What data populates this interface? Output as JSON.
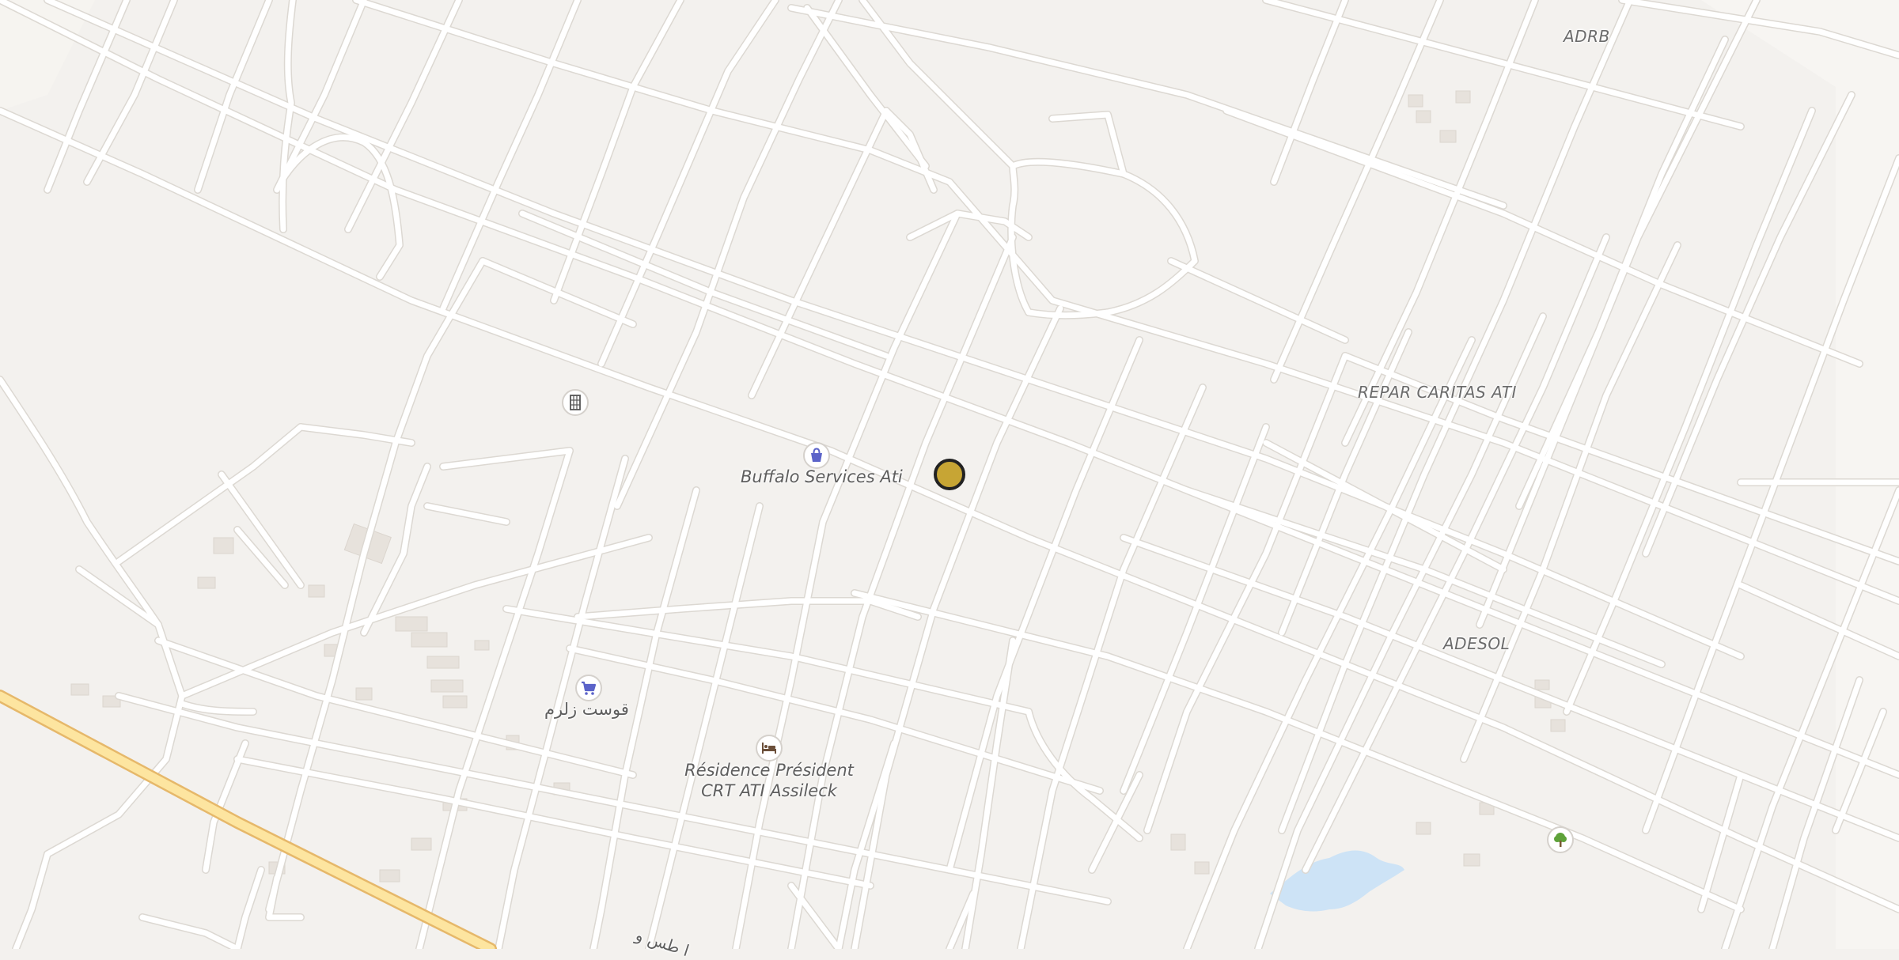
{
  "map": {
    "places": {
      "adrb": "ADRB",
      "repar_caritas": "REPAR CARITAS ATI",
      "adesol": "ADESOL",
      "buffalo": "Buffalo Services Ati",
      "arabic_shop": "قوست زلرم",
      "residence_line1": "Résidence Président",
      "residence_line2": "CRT ATI Assileck",
      "road_arabic": "ا طس و"
    },
    "icons": {
      "building": "building-icon",
      "shopping_bag": "shopping-bag-icon",
      "cart": "shopping-cart-icon",
      "bed": "bed-icon",
      "tree": "tree-icon",
      "marker": "location-marker"
    },
    "colors": {
      "background": "#f3f1ee",
      "street": "#ffffff",
      "main_road": "#fde5a0",
      "water": "#cde3f6",
      "poi_icon": "#5b63c9",
      "park_icon": "#5ea23a",
      "marker": "#c7a534"
    }
  }
}
